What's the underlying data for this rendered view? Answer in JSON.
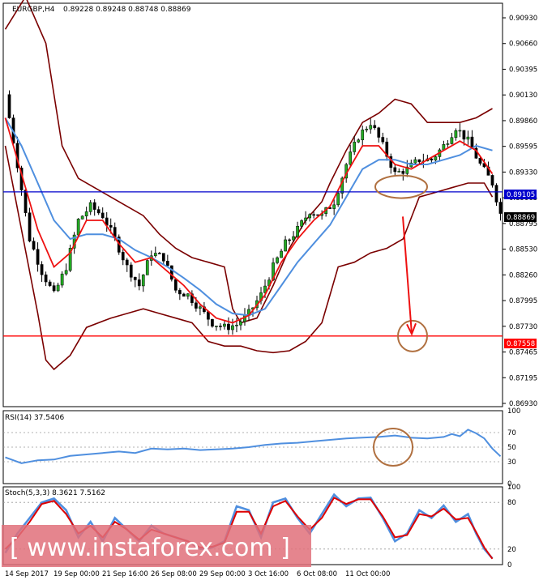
{
  "header": {
    "symbol": "EURGBP,H4",
    "ohlc": "0.89228 0.89248 0.88748 0.88869"
  },
  "rsi_label": "RSI(14) 37.5406",
  "stoch_label": "Stoch(5,3,3) 8.3621 7.5162",
  "watermark": "[ www.instaforex.com ]",
  "price_tags": {
    "blue_line": "0.89105",
    "current": "0.88869",
    "red_line": "0.87558"
  },
  "chart_data": [
    {
      "type": "candlestick",
      "title": "EURGBP,H4",
      "ylim": [
        0.868,
        0.9113
      ],
      "y_ticks": [
        "0.90930",
        "0.90660",
        "0.90395",
        "0.90130",
        "0.89860",
        "0.89595",
        "0.89330",
        "0.89065",
        "0.88795",
        "0.88530",
        "0.88260",
        "0.87995",
        "0.87730",
        "0.87465",
        "0.87195",
        "0.86930"
      ],
      "x_ticks": [
        "14 Sep 2017",
        "19 Sep 00:00",
        "21 Sep 16:00",
        "26 Sep 08:00",
        "29 Sep 00:00",
        "3 Oct 16:00",
        "6 Oct 08:00",
        "11 Oct 00:00"
      ],
      "horizontal_lines": [
        {
          "value": 0.89105,
          "color": "#0000cc"
        },
        {
          "value": 0.87558,
          "color": "#ff0000"
        }
      ],
      "close_path": [
        [
          0,
          0.9015
        ],
        [
          3,
          0.894
        ],
        [
          6,
          0.886
        ],
        [
          9,
          0.8825
        ],
        [
          12,
          0.88
        ],
        [
          15,
          0.883
        ],
        [
          18,
          0.888
        ],
        [
          21,
          0.8895
        ],
        [
          24,
          0.8885
        ],
        [
          27,
          0.886
        ],
        [
          30,
          0.883
        ],
        [
          33,
          0.881
        ],
        [
          36,
          0.8845
        ],
        [
          39,
          0.884
        ],
        [
          42,
          0.8805
        ],
        [
          45,
          0.88
        ],
        [
          48,
          0.8785
        ],
        [
          51,
          0.877
        ],
        [
          54,
          0.8765
        ],
        [
          57,
          0.8768
        ],
        [
          60,
          0.878
        ],
        [
          63,
          0.88
        ],
        [
          66,
          0.883
        ],
        [
          69,
          0.8855
        ],
        [
          72,
          0.887
        ],
        [
          75,
          0.889
        ],
        [
          78,
          0.8885
        ],
        [
          81,
          0.89
        ],
        [
          84,
          0.894
        ],
        [
          87,
          0.897
        ],
        [
          90,
          0.8985
        ],
        [
          93,
          0.896
        ],
        [
          96,
          0.893
        ],
        [
          99,
          0.8935
        ],
        [
          102,
          0.8945
        ],
        [
          105,
          0.8945
        ],
        [
          108,
          0.896
        ],
        [
          111,
          0.898
        ],
        [
          114,
          0.8965
        ],
        [
          117,
          0.894
        ],
        [
          120,
          0.892
        ],
        [
          122,
          0.8887
        ]
      ],
      "upper_band": [
        [
          0,
          0.9085
        ],
        [
          5,
          0.912
        ],
        [
          10,
          0.907
        ],
        [
          14,
          0.896
        ],
        [
          18,
          0.8925
        ],
        [
          22,
          0.8915
        ],
        [
          26,
          0.8905
        ],
        [
          30,
          0.8895
        ],
        [
          34,
          0.8885
        ],
        [
          38,
          0.8865
        ],
        [
          42,
          0.885
        ],
        [
          46,
          0.884
        ],
        [
          50,
          0.8835
        ],
        [
          54,
          0.883
        ],
        [
          56,
          0.8785
        ],
        [
          58,
          0.877
        ],
        [
          62,
          0.8775
        ],
        [
          66,
          0.881
        ],
        [
          70,
          0.885
        ],
        [
          74,
          0.888
        ],
        [
          78,
          0.89
        ],
        [
          80,
          0.892
        ],
        [
          84,
          0.8955
        ],
        [
          88,
          0.8985
        ],
        [
          92,
          0.8995
        ],
        [
          96,
          0.901
        ],
        [
          100,
          0.9005
        ],
        [
          104,
          0.8985
        ],
        [
          108,
          0.8985
        ],
        [
          112,
          0.8985
        ],
        [
          116,
          0.899
        ],
        [
          120,
          0.9
        ]
      ],
      "lower_band": [
        [
          0,
          0.896
        ],
        [
          4,
          0.887
        ],
        [
          8,
          0.878
        ],
        [
          10,
          0.873
        ],
        [
          12,
          0.872
        ],
        [
          16,
          0.8735
        ],
        [
          20,
          0.8765
        ],
        [
          26,
          0.8775
        ],
        [
          30,
          0.878
        ],
        [
          34,
          0.8785
        ],
        [
          38,
          0.878
        ],
        [
          42,
          0.8775
        ],
        [
          46,
          0.877
        ],
        [
          50,
          0.875
        ],
        [
          54,
          0.8745
        ],
        [
          58,
          0.8745
        ],
        [
          62,
          0.874
        ],
        [
          66,
          0.8738
        ],
        [
          70,
          0.874
        ],
        [
          74,
          0.875
        ],
        [
          78,
          0.877
        ],
        [
          80,
          0.88
        ],
        [
          82,
          0.883
        ],
        [
          86,
          0.8835
        ],
        [
          90,
          0.8845
        ],
        [
          94,
          0.885
        ],
        [
          98,
          0.886
        ],
        [
          102,
          0.8905
        ],
        [
          106,
          0.891
        ],
        [
          110,
          0.8915
        ],
        [
          114,
          0.892
        ],
        [
          118,
          0.892
        ],
        [
          120,
          0.8905
        ]
      ],
      "ma_fast": [
        [
          0,
          0.899
        ],
        [
          4,
          0.893
        ],
        [
          8,
          0.887
        ],
        [
          12,
          0.883
        ],
        [
          16,
          0.8845
        ],
        [
          20,
          0.888
        ],
        [
          24,
          0.888
        ],
        [
          28,
          0.8855
        ],
        [
          32,
          0.8835
        ],
        [
          36,
          0.884
        ],
        [
          40,
          0.8825
        ],
        [
          44,
          0.881
        ],
        [
          48,
          0.879
        ],
        [
          52,
          0.8775
        ],
        [
          56,
          0.877
        ],
        [
          60,
          0.8778
        ],
        [
          64,
          0.88
        ],
        [
          68,
          0.8835
        ],
        [
          72,
          0.886
        ],
        [
          76,
          0.888
        ],
        [
          80,
          0.8895
        ],
        [
          84,
          0.893
        ],
        [
          88,
          0.896
        ],
        [
          92,
          0.896
        ],
        [
          96,
          0.894
        ],
        [
          100,
          0.8935
        ],
        [
          104,
          0.8945
        ],
        [
          108,
          0.8955
        ],
        [
          112,
          0.8965
        ],
        [
          116,
          0.8955
        ],
        [
          120,
          0.893
        ]
      ],
      "ma_slow": [
        [
          0,
          0.899
        ],
        [
          4,
          0.896
        ],
        [
          8,
          0.892
        ],
        [
          12,
          0.888
        ],
        [
          16,
          0.886
        ],
        [
          20,
          0.8865
        ],
        [
          24,
          0.8865
        ],
        [
          28,
          0.886
        ],
        [
          32,
          0.8848
        ],
        [
          36,
          0.884
        ],
        [
          40,
          0.883
        ],
        [
          44,
          0.8818
        ],
        [
          48,
          0.8805
        ],
        [
          52,
          0.879
        ],
        [
          56,
          0.878
        ],
        [
          60,
          0.8778
        ],
        [
          64,
          0.8785
        ],
        [
          68,
          0.881
        ],
        [
          72,
          0.8835
        ],
        [
          76,
          0.8855
        ],
        [
          80,
          0.8875
        ],
        [
          84,
          0.8905
        ],
        [
          88,
          0.8935
        ],
        [
          92,
          0.8945
        ],
        [
          96,
          0.8945
        ],
        [
          100,
          0.894
        ],
        [
          104,
          0.894
        ],
        [
          108,
          0.8945
        ],
        [
          112,
          0.895
        ],
        [
          116,
          0.896
        ],
        [
          120,
          0.8955
        ]
      ]
    },
    {
      "type": "line",
      "title": "RSI(14) 37.5406",
      "ylim": [
        0,
        100
      ],
      "y_ticks": [
        "100",
        "70",
        "50",
        "30",
        "0"
      ],
      "series": [
        {
          "color": "#4f8fdf",
          "values": [
            [
              0,
              36
            ],
            [
              4,
              28
            ],
            [
              8,
              32
            ],
            [
              12,
              33
            ],
            [
              16,
              38
            ],
            [
              20,
              40
            ],
            [
              24,
              42
            ],
            [
              28,
              44
            ],
            [
              32,
              42
            ],
            [
              36,
              48
            ],
            [
              40,
              47
            ],
            [
              44,
              48
            ],
            [
              48,
              46
            ],
            [
              52,
              47
            ],
            [
              56,
              48
            ],
            [
              60,
              50
            ],
            [
              64,
              53
            ],
            [
              68,
              55
            ],
            [
              72,
              56
            ],
            [
              76,
              58
            ],
            [
              80,
              60
            ],
            [
              84,
              62
            ],
            [
              88,
              63
            ],
            [
              92,
              64
            ],
            [
              96,
              66
            ],
            [
              100,
              63
            ],
            [
              104,
              62
            ],
            [
              108,
              64
            ],
            [
              110,
              68
            ],
            [
              112,
              65
            ],
            [
              114,
              74
            ],
            [
              116,
              69
            ],
            [
              118,
              62
            ],
            [
              120,
              48
            ],
            [
              122,
              37.5
            ]
          ]
        }
      ]
    },
    {
      "type": "line",
      "title": "Stoch(5,3,3) 8.3621 7.5162",
      "ylim": [
        0,
        100
      ],
      "y_ticks": [
        "100",
        "80",
        "20",
        "0"
      ],
      "series": [
        {
          "color": "#4f8fdf",
          "values": [
            [
              0,
              15
            ],
            [
              3,
              40
            ],
            [
              6,
              60
            ],
            [
              9,
              80
            ],
            [
              12,
              85
            ],
            [
              15,
              70
            ],
            [
              18,
              35
            ],
            [
              21,
              55
            ],
            [
              24,
              30
            ],
            [
              27,
              60
            ],
            [
              30,
              45
            ],
            [
              33,
              30
            ],
            [
              36,
              50
            ],
            [
              39,
              40
            ],
            [
              42,
              35
            ],
            [
              45,
              30
            ],
            [
              48,
              20
            ],
            [
              51,
              22
            ],
            [
              54,
              30
            ],
            [
              57,
              75
            ],
            [
              60,
              70
            ],
            [
              63,
              35
            ],
            [
              66,
              80
            ],
            [
              69,
              85
            ],
            [
              72,
              60
            ],
            [
              75,
              40
            ],
            [
              78,
              65
            ],
            [
              81,
              90
            ],
            [
              84,
              75
            ],
            [
              87,
              85
            ],
            [
              90,
              86
            ],
            [
              93,
              60
            ],
            [
              96,
              30
            ],
            [
              99,
              40
            ],
            [
              102,
              70
            ],
            [
              105,
              60
            ],
            [
              108,
              76
            ],
            [
              111,
              55
            ],
            [
              114,
              65
            ],
            [
              116,
              40
            ],
            [
              118,
              20
            ],
            [
              120,
              8
            ]
          ]
        },
        {
          "color": "#dd0000",
          "values": [
            [
              0,
              20
            ],
            [
              3,
              35
            ],
            [
              6,
              55
            ],
            [
              9,
              78
            ],
            [
              12,
              82
            ],
            [
              15,
              65
            ],
            [
              18,
              40
            ],
            [
              21,
              50
            ],
            [
              24,
              35
            ],
            [
              27,
              55
            ],
            [
              30,
              45
            ],
            [
              33,
              32
            ],
            [
              36,
              45
            ],
            [
              39,
              40
            ],
            [
              42,
              35
            ],
            [
              45,
              30
            ],
            [
              48,
              22
            ],
            [
              51,
              23
            ],
            [
              54,
              28
            ],
            [
              57,
              68
            ],
            [
              60,
              68
            ],
            [
              63,
              40
            ],
            [
              66,
              75
            ],
            [
              69,
              82
            ],
            [
              72,
              62
            ],
            [
              75,
              45
            ],
            [
              78,
              60
            ],
            [
              81,
              86
            ],
            [
              84,
              78
            ],
            [
              87,
              84
            ],
            [
              90,
              84
            ],
            [
              93,
              62
            ],
            [
              96,
              35
            ],
            [
              99,
              38
            ],
            [
              102,
              65
            ],
            [
              105,
              62
            ],
            [
              108,
              72
            ],
            [
              111,
              58
            ],
            [
              114,
              60
            ],
            [
              116,
              42
            ],
            [
              118,
              22
            ],
            [
              120,
              7.5
            ]
          ]
        }
      ]
    }
  ]
}
